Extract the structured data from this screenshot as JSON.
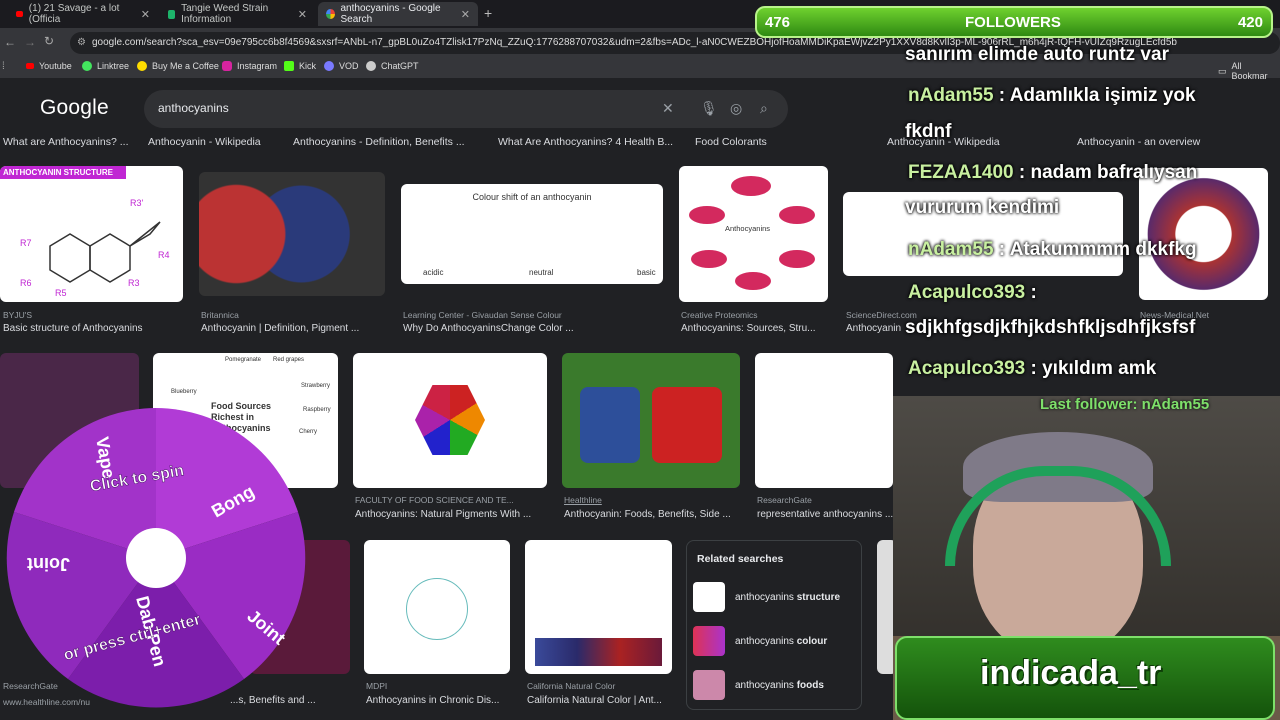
{
  "tabs": [
    {
      "title": "(1) 21 Savage - a lot (Officia"
    },
    {
      "title": "Tangie Weed Strain Information"
    },
    {
      "title": "anthocyanins - Google Search"
    }
  ],
  "url": "google.com/search?sca_esv=09e795cc6b8f4569&sxsrf=ANbL-n7_gpBL0uZo4TZlisk17PzNq_ZZuQ:1776288707032&udm=2&fbs=ADc_l-aN0CWEZBOHjofHoaMMDiKpaEWjvZ2Py1XXV8d8KvlI3p-ML-906rRL_m6h4jR-tQFH-vUIZq9RzugLEcfd5b",
  "bookmarks": [
    "Youtube",
    "Linktree",
    "Buy Me a Coffee",
    "Instagram",
    "Kick",
    "VOD",
    "ChatGPT"
  ],
  "all_bookmarks": "All Bookmar",
  "google_logo": "Google",
  "search_query": "anthocyanins",
  "chips": [
    "What are Anthocyanins? ...",
    "Anthocyanin - Wikipedia",
    "Anthocyanins - Definition, Benefits ...",
    "What Are Anthocyanins? 4 Health B...",
    "Food Colorants",
    "Anthocyanin - Wikipedia",
    "Anthocyanin - an overview"
  ],
  "row1": [
    {
      "label": "ANTHOCYANIN STRUCTURE",
      "source": "BYJU'S",
      "title": "Basic structure of Anthocyanins"
    },
    {
      "source": "Britannica",
      "title": "Anthocyanin | Definition, Pigment ..."
    },
    {
      "caption": "Colour shift of an anthocyanin",
      "sub": [
        "acidic",
        "neutral",
        "basic"
      ],
      "source": "Learning Center - Givaudan Sense Colour",
      "title": "Why Do AnthocyaninsChange Color ..."
    },
    {
      "center": "Anthocyanins",
      "source": "Creative Proteomics",
      "title": "Anthocyanins: Sources, Stru..."
    },
    {
      "source": "ScienceDirect.com",
      "title": "Anthocyanin"
    },
    {
      "source": "News-Medical.Net",
      "title": ""
    }
  ],
  "row2": [
    {
      "caption": "Food Sources Richest in Anthocyanins",
      "sub": [
        "Pomegranate",
        "Red grapes",
        "Blueberry",
        "Strawberry",
        "Raspberry",
        "Cherry"
      ]
    },
    {
      "source": "FACULTY OF FOOD SCIENCE AND TE...",
      "title": "Anthocyanins: Natural Pigments With ..."
    },
    {
      "source": "Healthline",
      "title": "Anthocyanin: Foods, Benefits, Side ..."
    },
    {
      "source": "ResearchGate",
      "title": "representative anthocyanins ..."
    }
  ],
  "row3": [
    {
      "source": "MDPI",
      "title": "Anthocyanins in Chronic Dis..."
    },
    {
      "source": "California Natural Color",
      "title": "California Natural Color | Ant..."
    },
    {
      "source": "ResearchGate",
      "title": ""
    },
    {
      "source": "www.healthline.com/nu",
      "title": "...s, Benefits and ..."
    }
  ],
  "related": {
    "heading": "Related searches",
    "items": [
      {
        "prefix": "anthocyanins ",
        "bold": "structure"
      },
      {
        "prefix": "anthocyanins ",
        "bold": "colour"
      },
      {
        "prefix": "anthocyanins ",
        "bold": "foods"
      }
    ]
  },
  "overlay": {
    "followers_label": "FOLLOWERS",
    "followers_current": "476",
    "followers_goal": "420",
    "chat": [
      {
        "text": "sanırım elimde auto runtz var"
      },
      {
        "name": "nAdam55",
        "text": " : Adamlıkla işimiz yok"
      },
      {
        "text": "fkdnf"
      },
      {
        "name": "FEZAA1400",
        "text": " : nadam bafralıysan"
      },
      {
        "text": "vururum kendimi"
      },
      {
        "name": "nAdam55",
        "text": " : Atakummmm dkkfkg"
      },
      {
        "name": "Acapulco393",
        "text": " :"
      },
      {
        "text": "sdjkhfgsdjkfhjkdshfkljsdhfjksfsf"
      },
      {
        "name": "Acapulco393",
        "text": " : yıkıldım amk"
      }
    ],
    "last_follower": "Last follower: nAdam55",
    "streamer": "indicada_tr",
    "wheel": {
      "line1": "Click to spin",
      "line2": "or press ctrl+enter",
      "segments": [
        "Bong",
        "Joint",
        "Joint",
        "Dab Pen",
        "Vape"
      ]
    }
  },
  "colors": {
    "google_bg": "#202124",
    "accent_green": "#6fd12f",
    "wheel_purple": "#a233c9"
  }
}
